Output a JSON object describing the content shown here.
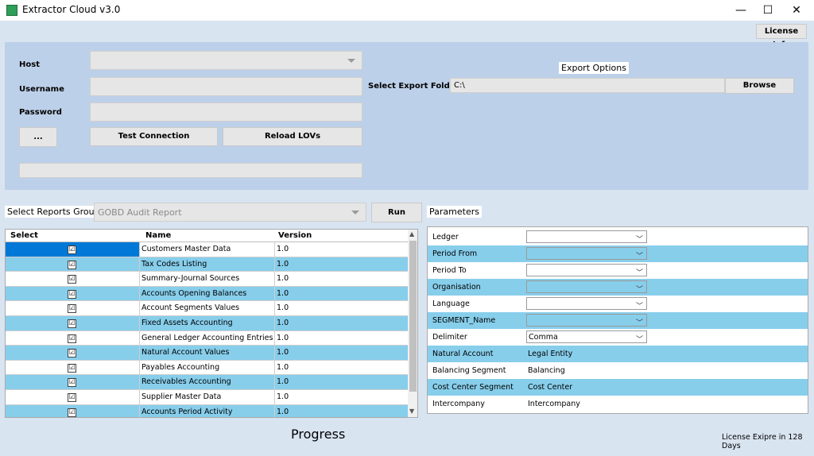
{
  "window": {
    "title": "Extractor Cloud v3.0",
    "minimize": "—",
    "maximize": "☐",
    "close": "✕"
  },
  "toolbar": {
    "license_info": "License Info"
  },
  "connection": {
    "host_label": "Host",
    "host_value": "",
    "username_label": "Username",
    "username_value": "",
    "password_label": "Password",
    "password_value": "",
    "dots_button": "...",
    "test_connection_button": "Test Connection",
    "reload_lovs_button": "Reload LOVs",
    "status_value": ""
  },
  "export": {
    "options_label": "Export Options",
    "folder_label": "Select Export Folder",
    "folder_value": "C:\\",
    "browse_button": "Browse"
  },
  "reports": {
    "group_label": "Select Reports Group",
    "group_value": "GOBD Audit Report",
    "run_button": "Run",
    "columns": [
      "Select",
      "Name",
      "Version"
    ],
    "rows": [
      {
        "checked": "☑",
        "name": "Customers Master Data",
        "version": "1.0"
      },
      {
        "checked": "☑",
        "name": "Tax Codes Listing",
        "version": "1.0"
      },
      {
        "checked": "☑",
        "name": "Summary-Journal Sources",
        "version": "1.0"
      },
      {
        "checked": "☑",
        "name": "Accounts Opening Balances",
        "version": "1.0"
      },
      {
        "checked": "☑",
        "name": "Account Segments Values",
        "version": "1.0"
      },
      {
        "checked": "☑",
        "name": "Fixed Assets Accounting",
        "version": "1.0"
      },
      {
        "checked": "☑",
        "name": "General Ledger Accounting Entries",
        "version": "1.0"
      },
      {
        "checked": "☑",
        "name": "Natural Account Values",
        "version": "1.0"
      },
      {
        "checked": "☑",
        "name": "Payables Accounting",
        "version": "1.0"
      },
      {
        "checked": "☑",
        "name": "Receivables Accounting",
        "version": "1.0"
      },
      {
        "checked": "☑",
        "name": "Supplier Master Data",
        "version": "1.0"
      },
      {
        "checked": "☑",
        "name": "Accounts Period Activity",
        "version": "1.0"
      }
    ]
  },
  "parameters": {
    "label": "Parameters",
    "rows": [
      {
        "label": "Ledger",
        "value": "",
        "kind": "combo"
      },
      {
        "label": "Period From",
        "value": "",
        "kind": "combo"
      },
      {
        "label": "Period To",
        "value": "",
        "kind": "combo"
      },
      {
        "label": "Organisation",
        "value": "",
        "kind": "combo"
      },
      {
        "label": "Language",
        "value": "",
        "kind": "combo"
      },
      {
        "label": "SEGMENT_Name",
        "value": "",
        "kind": "combo"
      },
      {
        "label": "Delimiter",
        "value": "Comma",
        "kind": "combo"
      },
      {
        "label": "Natural Account",
        "value": "Legal Entity",
        "kind": "text"
      },
      {
        "label": "Balancing Segment",
        "value": "Balancing",
        "kind": "text"
      },
      {
        "label": "Cost Center Segment",
        "value": "Cost Center",
        "kind": "text"
      },
      {
        "label": "Intercompany",
        "value": "Intercompany",
        "kind": "text"
      }
    ]
  },
  "footer": {
    "progress_label": "Progress",
    "license_text": "License Exipre in 128 Days"
  },
  "icons": {
    "dropdown": "chevron-down-icon",
    "scroll_up": "scroll-up-icon",
    "scroll_down": "scroll-down-icon"
  },
  "colors": {
    "selected_row": "#0078d7",
    "alt_row": "#87ceeb",
    "panel": "#bdd0e9",
    "client": "#d9e4f1"
  }
}
